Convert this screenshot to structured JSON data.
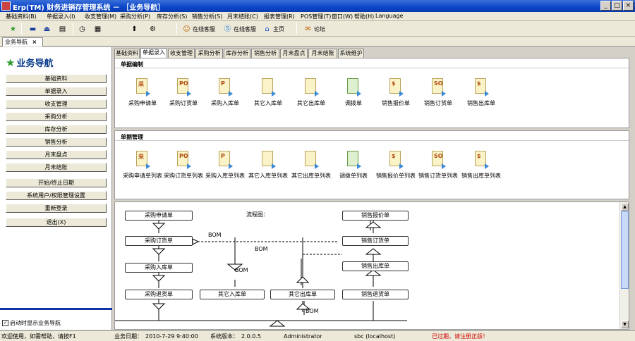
{
  "window": {
    "title": "Erp(TM) 财务进销存管理系统 － ［业务导航］",
    "buttons": {
      "minimize": "_",
      "maximize": "□",
      "close": "×"
    }
  },
  "menu": [
    "基础资料(B)",
    "单据录入(I)",
    "收支管理(M)",
    "采购分析(P)",
    "库存分析(S)",
    "销售分析(S)",
    "月末结账(C)",
    "报表管理(R)",
    "POS管理(T)",
    "窗口(W)",
    "帮助(H)",
    "Language"
  ],
  "toolbar": {
    "buttons": [
      {
        "icon": "star-icon",
        "glyph": "★",
        "label": ""
      },
      {
        "icon": "dot-icon",
        "glyph": "▬",
        "label": ""
      },
      {
        "icon": "eject-icon",
        "glyph": "⏏",
        "label": ""
      },
      {
        "icon": "dos-icon",
        "glyph": "▤",
        "label": ""
      },
      {
        "icon": "clock-icon",
        "glyph": "◷",
        "label": ""
      },
      {
        "icon": "calc-icon",
        "glyph": "▦",
        "label": ""
      },
      {
        "icon": "pin-icon",
        "glyph": "⬆",
        "label": ""
      },
      {
        "icon": "tools-icon",
        "glyph": "⚙",
        "label": ""
      }
    ],
    "text_buttons": [
      {
        "icon": "chat-icon",
        "glyph": "☺",
        "label": "在线客服"
      },
      {
        "icon": "skype-icon",
        "glyph": "Ⓢ",
        "label": "在线客服"
      },
      {
        "icon": "company-icon",
        "glyph": "⌂",
        "label": "主页"
      },
      {
        "icon": "forum-icon",
        "glyph": "✉",
        "label": "论坛"
      }
    ]
  },
  "doc_tab": {
    "label": "业务导航",
    "close": "×"
  },
  "nav": {
    "title": "业务导航",
    "items": [
      "基础资料",
      "单据录入",
      "收支管理",
      "采购分析",
      "库存分析",
      "销售分析",
      "月末盘点",
      "月末结账",
      "开始/终止日期",
      "系统用户/权限管理设置",
      "重新登录",
      "退出(X)"
    ],
    "auto_show_label": "启动时显示业务导航",
    "auto_show_checked": "✓"
  },
  "function_tabs": [
    "基础资料",
    "单据录入",
    "收支管理",
    "采购分析",
    "库存分析",
    "销售分析",
    "月末盘点",
    "月末结账",
    "系统维护"
  ],
  "active_tab_index": 1,
  "sections": {
    "entry": {
      "title": "单据编制",
      "docs": [
        {
          "label": "采购申请单",
          "ch": "采",
          "green": false
        },
        {
          "label": "采购订货单",
          "ch": "PO",
          "green": false
        },
        {
          "label": "采购入库单",
          "ch": "P",
          "green": false
        },
        {
          "label": "其它入库单",
          "ch": "",
          "green": false
        },
        {
          "label": "其它出库单",
          "ch": "",
          "green": false
        },
        {
          "label": "调拨单",
          "ch": "",
          "green": true
        },
        {
          "label": "销售报价单",
          "ch": "$",
          "green": false
        },
        {
          "label": "销售订货单",
          "ch": "SO",
          "green": false
        },
        {
          "label": "销售出库单",
          "ch": "$",
          "green": false
        }
      ]
    },
    "list": {
      "title": "单据管理",
      "docs": [
        {
          "label": "采购申请单列表",
          "ch": "采",
          "green": false
        },
        {
          "label": "采购订货单列表",
          "ch": "PO",
          "green": false
        },
        {
          "label": "采购入库单列表",
          "ch": "P",
          "green": false
        },
        {
          "label": "其它入库单列表",
          "ch": "",
          "green": false
        },
        {
          "label": "其它出库单列表",
          "ch": "",
          "green": false
        },
        {
          "label": "调拨单列表",
          "ch": "",
          "green": true
        },
        {
          "label": "销售报价单列表",
          "ch": "$",
          "green": false
        },
        {
          "label": "销售订货单列表",
          "ch": "SO",
          "green": false
        },
        {
          "label": "销售出库单列表",
          "ch": "$",
          "green": false
        }
      ]
    }
  },
  "flow": {
    "caption": "流程图：",
    "boxes": {
      "purchase_request": "采购申请单",
      "purchase_order": "采购订货单",
      "purchase_in": "采购入库单",
      "purchase_return": "采购退货单",
      "other_in": "其它入库单",
      "other_out": "其它出库单",
      "sales_quote": "销售报价单",
      "sales_order": "销售订货单",
      "sales_out": "销售出库单",
      "sales_return": "销售退货单"
    },
    "labels": {
      "bom1": "BOM",
      "bom2": "BOM",
      "bom3": "BOM",
      "bom4": "BOM"
    }
  },
  "status": {
    "welcome": "欢迎使用，如需帮助，请按F1",
    "date_label": "业务日期：",
    "date_value": "2010-7-29 9:40:00",
    "version_label": "系统版本：",
    "version_value": "2.0.0.5",
    "user": "Administrator",
    "db": "sbc (localhost)",
    "warning": "已过期，请注册正版！"
  }
}
